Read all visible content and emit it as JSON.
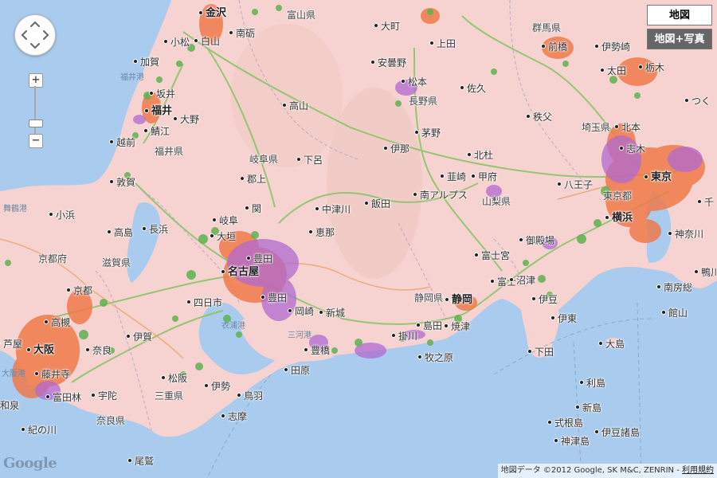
{
  "map": {
    "controls": {
      "zoom_in": "+",
      "zoom_out": "−",
      "map_type_map": "地図",
      "map_type_satellite": "地図+写真"
    },
    "attribution": "地図データ ©2012 Google, SK M&C, ZENRIN - ",
    "terms": "利用規約",
    "logo": "Google",
    "colors": {
      "land": "#f6d2d0",
      "sea": "#a9cbee",
      "coverage_orange": "#f07a4a",
      "coverage_purple": "#b06ad0",
      "coverage_green": "#5db34f",
      "road": "#b9d89a"
    },
    "labels": [
      {
        "text": "金沢",
        "cls": "big"
      },
      {
        "text": "富山県",
        "cls": "pref"
      },
      {
        "text": "群馬県",
        "cls": "pref"
      },
      {
        "text": "大町",
        "cls": ""
      },
      {
        "text": "上田",
        "cls": ""
      },
      {
        "text": "南砺",
        "cls": ""
      },
      {
        "text": "小松",
        "cls": ""
      },
      {
        "text": "白山",
        "cls": ""
      },
      {
        "text": "安曇野",
        "cls": ""
      },
      {
        "text": "前橋",
        "cls": ""
      },
      {
        "text": "伊勢崎",
        "cls": ""
      },
      {
        "text": "加賀",
        "cls": ""
      },
      {
        "text": "福井港",
        "cls": "water"
      },
      {
        "text": "松本",
        "cls": ""
      },
      {
        "text": "佐久",
        "cls": ""
      },
      {
        "text": "太田",
        "cls": ""
      },
      {
        "text": "栃木",
        "cls": ""
      },
      {
        "text": "坂井",
        "cls": ""
      },
      {
        "text": "福井",
        "cls": "big"
      },
      {
        "text": "高山",
        "cls": ""
      },
      {
        "text": "長野県",
        "cls": "pref"
      },
      {
        "text": "つく",
        "cls": ""
      },
      {
        "text": "大野",
        "cls": ""
      },
      {
        "text": "鯖江",
        "cls": ""
      },
      {
        "text": "秩父",
        "cls": ""
      },
      {
        "text": "埼玉県",
        "cls": "pref"
      },
      {
        "text": "北本",
        "cls": ""
      },
      {
        "text": "越前",
        "cls": ""
      },
      {
        "text": "福井県",
        "cls": "pref"
      },
      {
        "text": "茅野",
        "cls": ""
      },
      {
        "text": "伊那",
        "cls": ""
      },
      {
        "text": "北杜",
        "cls": ""
      },
      {
        "text": "志木",
        "cls": ""
      },
      {
        "text": "岐阜県",
        "cls": "pref"
      },
      {
        "text": "下呂",
        "cls": ""
      },
      {
        "text": "敦賀",
        "cls": ""
      },
      {
        "text": "郡上",
        "cls": ""
      },
      {
        "text": "韮崎",
        "cls": ""
      },
      {
        "text": "甲府",
        "cls": ""
      },
      {
        "text": "八王子",
        "cls": ""
      },
      {
        "text": "東京",
        "cls": "big"
      },
      {
        "text": "南アルプス",
        "cls": ""
      },
      {
        "text": "山梨県",
        "cls": "pref"
      },
      {
        "text": "東京都",
        "cls": "pref"
      },
      {
        "text": "舞鶴港",
        "cls": "water"
      },
      {
        "text": "小浜",
        "cls": ""
      },
      {
        "text": "関",
        "cls": ""
      },
      {
        "text": "中津川",
        "cls": ""
      },
      {
        "text": "飯田",
        "cls": ""
      },
      {
        "text": "千",
        "cls": ""
      },
      {
        "text": "岐阜",
        "cls": ""
      },
      {
        "text": "横浜",
        "cls": "big"
      },
      {
        "text": "高島",
        "cls": ""
      },
      {
        "text": "長浜",
        "cls": ""
      },
      {
        "text": "恵那",
        "cls": ""
      },
      {
        "text": "大垣",
        "cls": ""
      },
      {
        "text": "御殿場",
        "cls": ""
      },
      {
        "text": "神奈川",
        "cls": ""
      },
      {
        "text": "京都府",
        "cls": "pref"
      },
      {
        "text": "滋賀県",
        "cls": "pref"
      },
      {
        "text": "豊田",
        "cls": ""
      },
      {
        "text": "富士宮",
        "cls": ""
      },
      {
        "text": "南房総",
        "cls": ""
      },
      {
        "text": "名古屋",
        "cls": "big"
      },
      {
        "text": "鴨川",
        "cls": ""
      },
      {
        "text": "京都",
        "cls": ""
      },
      {
        "text": "富士",
        "cls": ""
      },
      {
        "text": "沼津",
        "cls": ""
      },
      {
        "text": "四日市",
        "cls": ""
      },
      {
        "text": "豊田",
        "cls": ""
      },
      {
        "text": "静岡県",
        "cls": "pref"
      },
      {
        "text": "静岡",
        "cls": "big"
      },
      {
        "text": "館山",
        "cls": ""
      },
      {
        "text": "伊豆",
        "cls": ""
      },
      {
        "text": "高槻",
        "cls": ""
      },
      {
        "text": "岡崎",
        "cls": ""
      },
      {
        "text": "新城",
        "cls": ""
      },
      {
        "text": "伊賀",
        "cls": ""
      },
      {
        "text": "伊東",
        "cls": ""
      },
      {
        "text": "衣浦港",
        "cls": "water"
      },
      {
        "text": "島田",
        "cls": ""
      },
      {
        "text": "焼津",
        "cls": ""
      },
      {
        "text": "芦屋",
        "cls": ""
      },
      {
        "text": "大阪",
        "cls": "big"
      },
      {
        "text": "掛川",
        "cls": ""
      },
      {
        "text": "三河港",
        "cls": "water"
      },
      {
        "text": "奈良",
        "cls": ""
      },
      {
        "text": "豊橋",
        "cls": ""
      },
      {
        "text": "大島",
        "cls": ""
      },
      {
        "text": "牧之原",
        "cls": ""
      },
      {
        "text": "大阪港",
        "cls": "water"
      },
      {
        "text": "藤井寺",
        "cls": ""
      },
      {
        "text": "田原",
        "cls": ""
      },
      {
        "text": "下田",
        "cls": ""
      },
      {
        "text": "松阪",
        "cls": ""
      },
      {
        "text": "伊勢",
        "cls": ""
      },
      {
        "text": "宇陀",
        "cls": ""
      },
      {
        "text": "三重県",
        "cls": "pref"
      },
      {
        "text": "鳥羽",
        "cls": ""
      },
      {
        "text": "富田林",
        "cls": ""
      },
      {
        "text": "和泉",
        "cls": ""
      },
      {
        "text": "利島",
        "cls": ""
      },
      {
        "text": "奈良県",
        "cls": "pref"
      },
      {
        "text": "志摩",
        "cls": ""
      },
      {
        "text": "新島",
        "cls": ""
      },
      {
        "text": "紀の川",
        "cls": ""
      },
      {
        "text": "式根島",
        "cls": ""
      },
      {
        "text": "伊豆諸島",
        "cls": ""
      },
      {
        "text": "神津島",
        "cls": ""
      },
      {
        "text": "尾鷲",
        "cls": ""
      }
    ]
  }
}
